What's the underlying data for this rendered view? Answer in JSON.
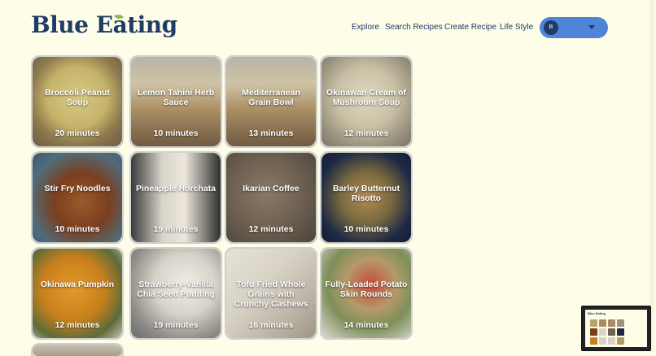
{
  "brand": {
    "name": "Blue Eating",
    "accent": "#1f3b66",
    "leaf": "#8ab85c"
  },
  "nav": {
    "explore": "Explore",
    "search": "Search Recipes",
    "create": "Create Recipe",
    "lifestyle": "Life Style"
  },
  "profile": {
    "initial": "B",
    "dropdown_icon": "chevron-down-icon"
  },
  "recipes": [
    {
      "title": "Broccoli Peanut Soup",
      "time": "20 minutes"
    },
    {
      "title": "Lemon Tahini Herb Sauce",
      "time": "10 minutes"
    },
    {
      "title": "Mediterranean Grain Bowl",
      "time": "13 minutes"
    },
    {
      "title": "Okinawan Cream of Mushroom Soup",
      "time": "12 minutes"
    },
    {
      "title": "Stir Fry Noodles",
      "time": "10 minutes"
    },
    {
      "title": "Pineapple Horchata",
      "time": "19 minutes"
    },
    {
      "title": "Ikarian Coffee",
      "time": "12 minutes"
    },
    {
      "title": "Barley Butternut Risotto",
      "time": "10 minutes"
    },
    {
      "title": "Okinawa Pumpkin",
      "time": "12 minutes"
    },
    {
      "title": "Strawberry-Vanilla Chia Seed Pudding",
      "time": "19 minutes"
    },
    {
      "title": "Tofu Fried Whole Grains with Crunchy Cashews",
      "time": "16 minutes"
    },
    {
      "title": "Fully-Loaded Potato Skin Rounds",
      "time": "14 minutes"
    }
  ]
}
